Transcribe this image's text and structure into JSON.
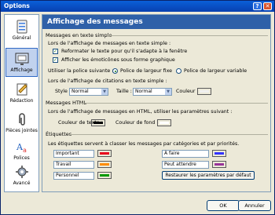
{
  "window": {
    "title": "Options",
    "help": "?",
    "close": "✕"
  },
  "sidebar": {
    "items": [
      {
        "label": "Général"
      },
      {
        "label": "Affichage"
      },
      {
        "label": "Rédaction"
      },
      {
        "label": "Pièces jointes"
      },
      {
        "label": "Polices"
      },
      {
        "label": "Avancé"
      }
    ]
  },
  "main": {
    "title": "Affichage des messages",
    "plain": {
      "title": "Messages en texte simple",
      "intro": "Lors de l'affichage de messages en texte simple :",
      "reformat": "Reformater le texte pour qu'il s'adapte à la fenêtre",
      "emoticons": "Afficher les émoticônes sous forme graphique",
      "font_label": "Utiliser la police suivante :",
      "fixed": "Police de largeur fixe",
      "variable": "Police de largeur variable",
      "quote_intro": "Lors de l'affichage de citations en texte simple :",
      "style_label": "Style :",
      "style_value": "Normal",
      "size_label": "Taille :",
      "size_value": "Normal",
      "color_label": "Couleur :"
    },
    "html": {
      "title": "Messages HTML",
      "intro": "Lors de l'affichage de messages en HTML, utiliser les paramètres suivant :",
      "text_color": "Couleur de texte :",
      "bg_color": "Couleur de fond :"
    },
    "tags": {
      "title": "Étiquettes",
      "intro": "Les étiquettes servent à classer les messages par catégories et par priorités.",
      "items": [
        {
          "label": "Important",
          "color": "#e8001c"
        },
        {
          "label": "Travail",
          "color": "#ff8c00"
        },
        {
          "label": "Personnel",
          "color": "#009900"
        },
        {
          "label": "À faire",
          "color": "#3333ff"
        },
        {
          "label": "Peut attendre",
          "color": "#993399"
        }
      ],
      "restore": "Restaurer les paramètres par défaut"
    }
  },
  "footer": {
    "ok": "OK",
    "cancel": "Annuler"
  },
  "colors": {
    "quote": "#f0f0f0",
    "text": "#000000",
    "background": "#ffffff"
  }
}
